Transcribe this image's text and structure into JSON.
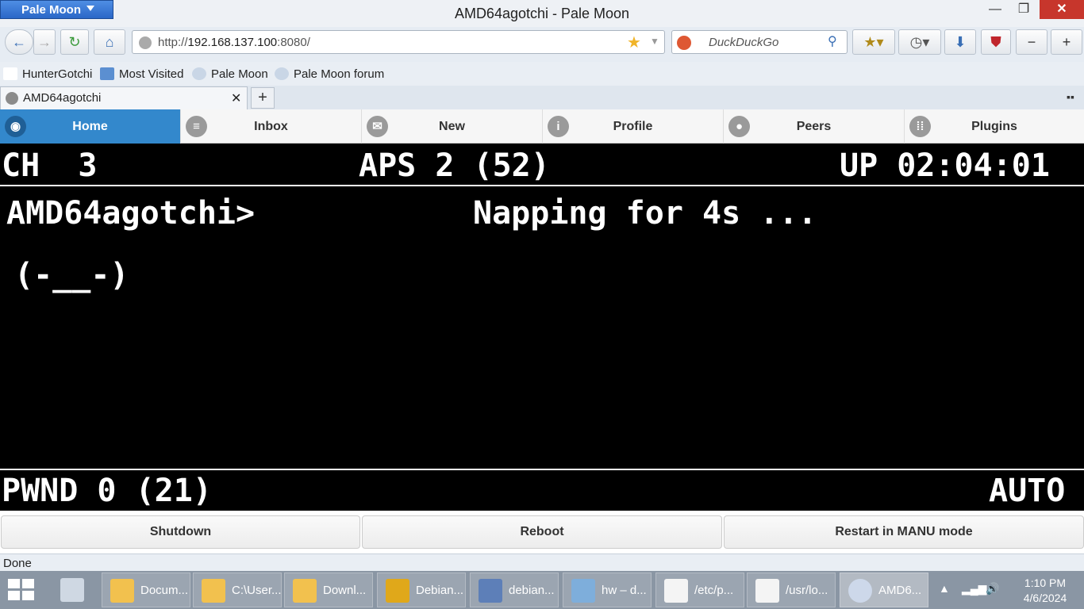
{
  "window": {
    "app_menu": "Pale Moon",
    "title": "AMD64agotchi - Pale Moon",
    "minimize": "—",
    "maximize": "❐",
    "close": "✕"
  },
  "navbar": {
    "back": "←",
    "forward": "→",
    "reload": "↻",
    "home": "⌂",
    "url_prefix": "http://",
    "url_host": "192.168.137.100",
    "url_suffix": ":8080/",
    "search_placeholder": "DuckDuckGo",
    "zoom_out": "−",
    "zoom_in": "+"
  },
  "bookmarks": [
    {
      "label": "HunterGotchi"
    },
    {
      "label": "Most Visited"
    },
    {
      "label": "Pale Moon"
    },
    {
      "label": "Pale Moon forum"
    }
  ],
  "tabs": {
    "active_label": "AMD64agotchi",
    "close": "✕",
    "new": "+",
    "list": "▪▪"
  },
  "page_nav": [
    {
      "label": "Home",
      "icon": "eye-icon",
      "glyph": "◉"
    },
    {
      "label": "Inbox",
      "icon": "list-icon",
      "glyph": "≡"
    },
    {
      "label": "New",
      "icon": "mail-icon",
      "glyph": "✉"
    },
    {
      "label": "Profile",
      "icon": "info-icon",
      "glyph": "i"
    },
    {
      "label": "Peers",
      "icon": "user-icon",
      "glyph": "●"
    },
    {
      "label": "Plugins",
      "icon": "grid-icon",
      "glyph": "⁞⁞"
    }
  ],
  "screen": {
    "channel": "CH  3",
    "aps": "APS 2 (52)",
    "uptime": "UP 02:04:01",
    "name": "AMD64agotchi>",
    "status": "Napping for 4s ...",
    "face": "(-__-)",
    "pwnd": "PWND 0 (21)",
    "mode": "AUTO"
  },
  "actions": {
    "shutdown": "Shutdown",
    "reboot": "Reboot",
    "restart_manu": "Restart in MANU mode"
  },
  "statusbar": {
    "text": "Done"
  },
  "taskbar": {
    "items": [
      {
        "label": "Docum..."
      },
      {
        "label": "C:\\User..."
      },
      {
        "label": "Downl..."
      },
      {
        "label": "Debian..."
      },
      {
        "label": "debian..."
      },
      {
        "label": "hw – d..."
      },
      {
        "label": "/etc/p..."
      },
      {
        "label": "/usr/lo..."
      },
      {
        "label": "AMD6..."
      }
    ],
    "time": "1:10 PM",
    "date": "4/6/2024"
  }
}
